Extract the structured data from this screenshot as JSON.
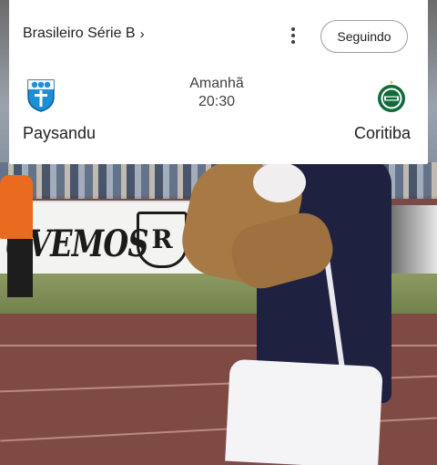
{
  "match_card": {
    "league_label": "Brasileiro Série B",
    "league_chevron": "›",
    "more_icon": "more-vert-icon",
    "follow_label": "Seguindo",
    "day": "Amanhã",
    "time": "20:30",
    "home_team": {
      "name": "Paysandu",
      "crest_icon": "paysandu-crest-icon",
      "color": "#1d8fd6"
    },
    "away_team": {
      "name": "Coritiba",
      "crest_icon": "coritiba-crest-icon",
      "color": "#0f6b3a"
    }
  }
}
